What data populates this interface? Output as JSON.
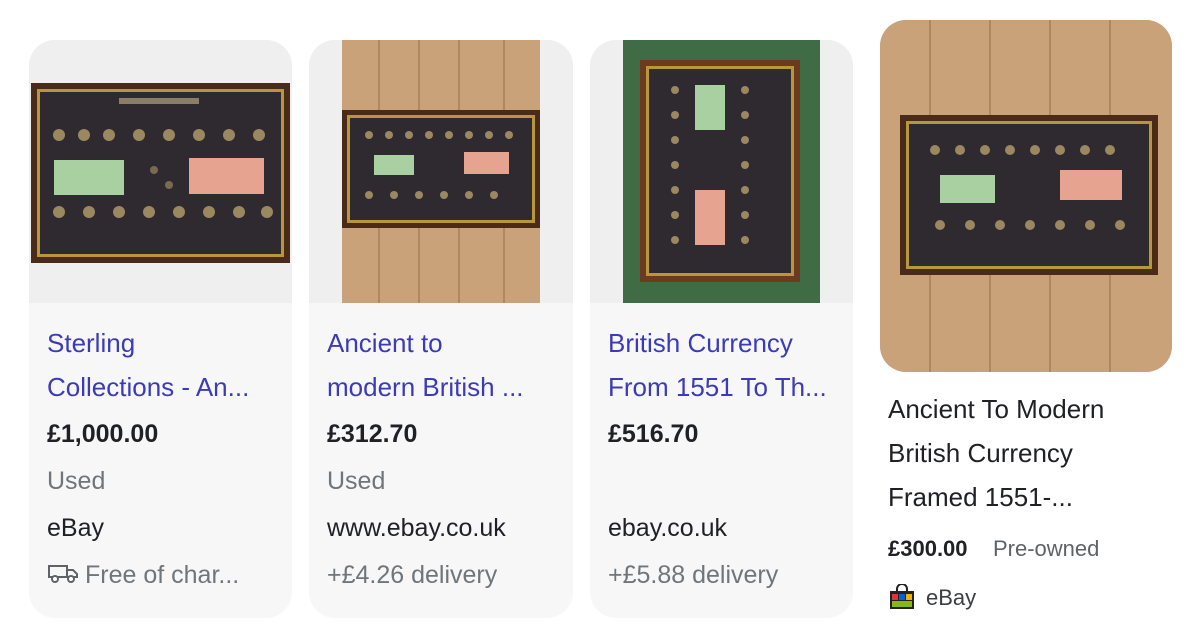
{
  "cards": [
    {
      "title_line1": "Sterling",
      "title_line2": "Collections - An...",
      "price": "£1,000.00",
      "condition": "Used",
      "source": "eBay",
      "delivery": "Free of char...",
      "delivery_icon": "truck-icon"
    },
    {
      "title_line1": "Ancient to",
      "title_line2": "modern British ...",
      "price": "£312.70",
      "condition": "Used",
      "source": "www.ebay.co.uk",
      "delivery": "+£4.26 delivery"
    },
    {
      "title_line1": "British Currency",
      "title_line2": "From 1551 To Th...",
      "price": "£516.70",
      "condition": "",
      "source": "ebay.co.uk",
      "delivery": "+£5.88 delivery"
    },
    {
      "title_line1": "Ancient To Modern",
      "title_line2": "British Currency",
      "title_line3": "Framed 1551-...",
      "price": "£300.00",
      "condition": "Pre-owned",
      "source": "eBay",
      "source_icon": "shopping-bag-icon"
    }
  ],
  "colors": {
    "title_link": "#3b3bb8",
    "card_bg": "#f7f7f8",
    "muted_text": "#70757a",
    "frame_wood": "#4a2a18",
    "frame_gold": "#b8963a",
    "floor_wood": "#c9a27a",
    "carpet_green": "#3f6b45"
  }
}
